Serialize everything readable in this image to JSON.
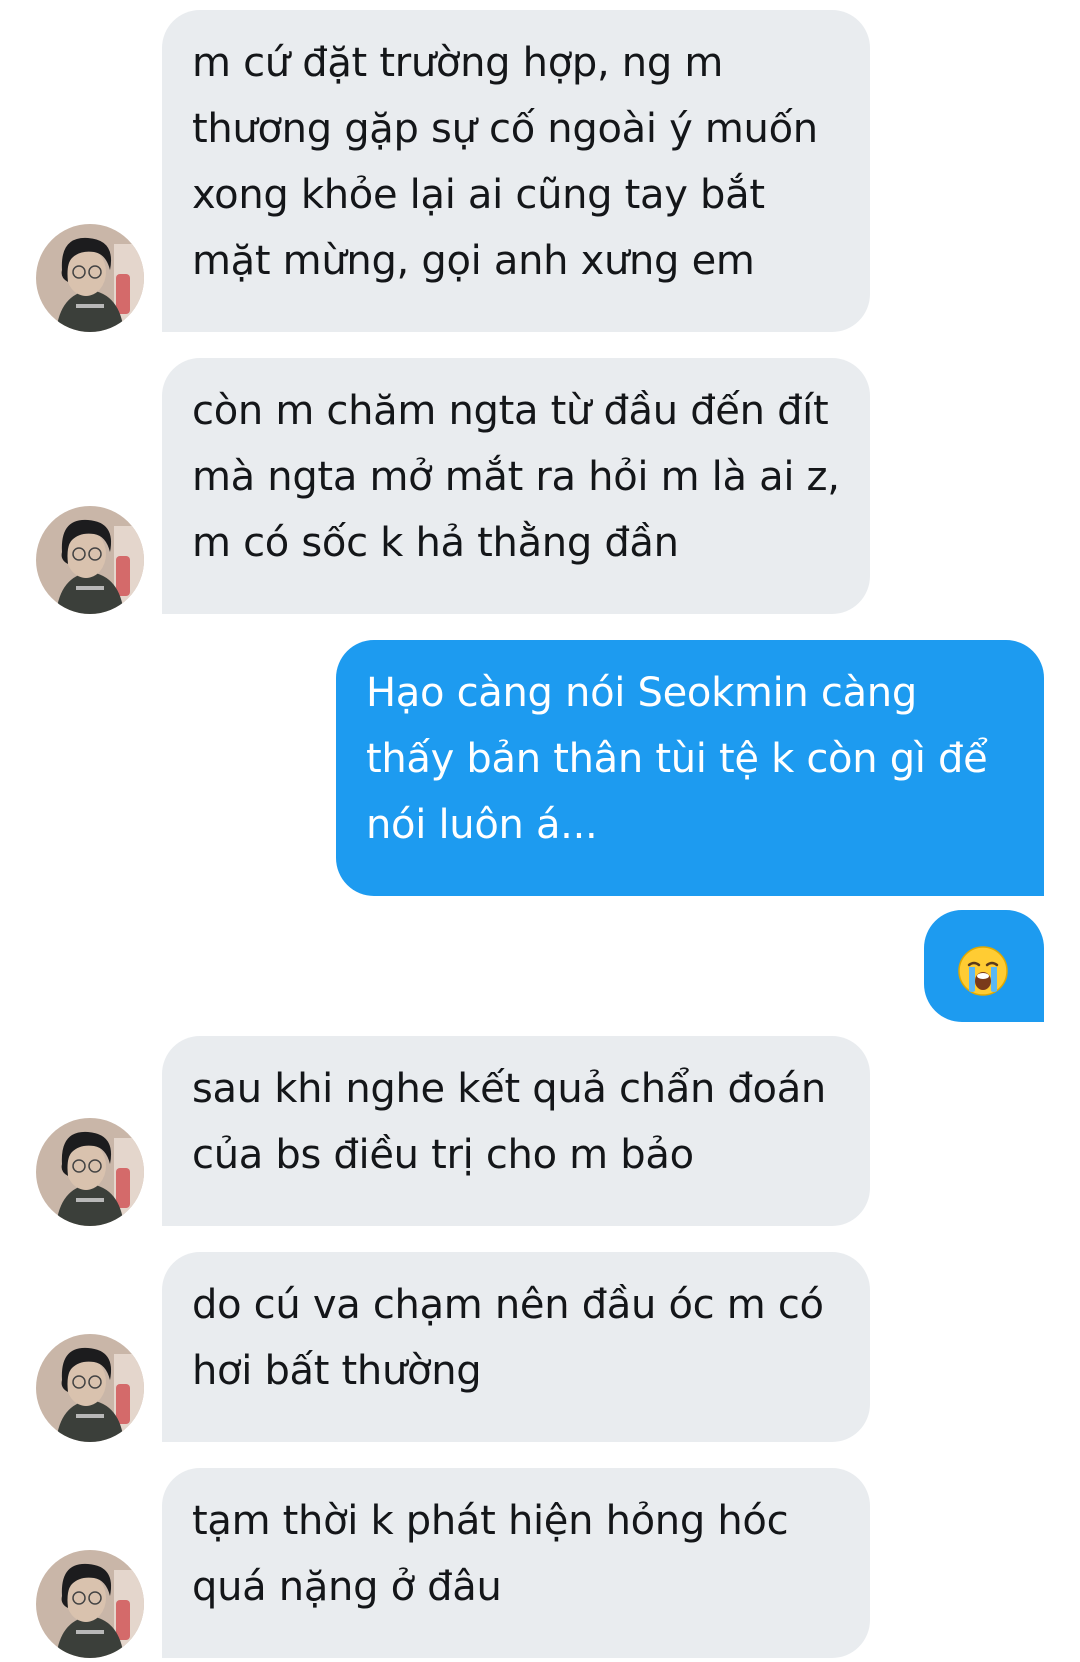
{
  "messages": [
    {
      "direction": "received",
      "text": "m cứ đặt trường hợp, ng m\nthương gặp sự cố ngoài ý muốn\nxong khỏe lại ai cũng tay bắt\nmặt mừng, gọi anh xưng em"
    },
    {
      "direction": "received",
      "text": "còn m chăm ngta từ đầu đến đít\nmà ngta mở mắt ra hỏi m là ai z,\nm có sốc k hả thằng đần"
    },
    {
      "direction": "sent",
      "text": "Hạo càng nói Seokmin càng\nthấy bản thân tùi tệ k còn gì để\nnói luôn á..."
    },
    {
      "direction": "sent",
      "emoji": "loudly-crying-face-emoji"
    },
    {
      "direction": "received",
      "text": "sau khi nghe kết quả chẩn đoán\ncủa bs điều trị cho m bảo"
    },
    {
      "direction": "received",
      "text": "do cú va chạm nên đầu óc m có\nhơi bất thường"
    },
    {
      "direction": "received",
      "text": "tạm thời k phát hiện hỏng hóc\nquá nặng ở đâu"
    }
  ],
  "colors": {
    "received_bubble": "#e9ecef",
    "received_text": "#141619",
    "sent_bubble": "#1d9bf0",
    "sent_text": "#ffffff"
  },
  "icons": {
    "avatar": "user-avatar-photo",
    "emoji": "loudly-crying-face"
  }
}
